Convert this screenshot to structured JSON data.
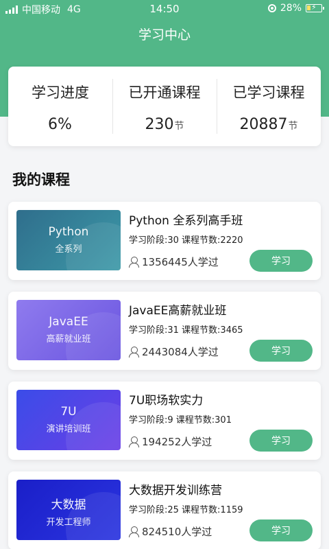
{
  "status_bar": {
    "carrier": "中国移动",
    "network": "4G",
    "time": "14:50",
    "battery": "28%",
    "battery_fraction": 0.28
  },
  "header": {
    "title": "学习中心"
  },
  "stats": [
    {
      "label": "学习进度",
      "value": "6%",
      "unit": ""
    },
    {
      "label": "已开通课程",
      "value": "230",
      "unit": "节"
    },
    {
      "label": "已学习课程",
      "value": "20887",
      "unit": "节"
    }
  ],
  "section": {
    "title": "我的课程"
  },
  "courses": [
    {
      "thumb_title": "Python",
      "thumb_sub": "全系列",
      "name": "Python 全系列高手班",
      "meta": "学习阶段:30 课程节数:2220",
      "learners": "1356445人学过",
      "button": "学习",
      "thumb_color_a": "#2f6e8c",
      "thumb_color_b": "#3d99a8"
    },
    {
      "thumb_title": "JavaEE",
      "thumb_sub": "高薪就业班",
      "name": "JavaEE高薪就业班",
      "meta": "学习阶段:31 课程节数:3465",
      "learners": "2443084人学过",
      "button": "学习",
      "thumb_color_a": "#8f7bee",
      "thumb_color_b": "#6a55e0"
    },
    {
      "thumb_title": "7U",
      "thumb_sub": "演讲培训班",
      "name": "7U职场软实力",
      "meta": "学习阶段:9 课程节数:301",
      "learners": "194252人学过",
      "button": "学习",
      "thumb_color_a": "#3b4ce8",
      "thumb_color_b": "#6a3fe6"
    },
    {
      "thumb_title": "大数据",
      "thumb_sub": "开发工程师",
      "name": "大数据开发训练营",
      "meta": "学习阶段:25 课程节数:1159",
      "learners": "824510人学过",
      "button": "学习",
      "thumb_color_a": "#1a1fc8",
      "thumb_color_b": "#2b34e0"
    }
  ],
  "colors": {
    "accent": "#52b788"
  }
}
